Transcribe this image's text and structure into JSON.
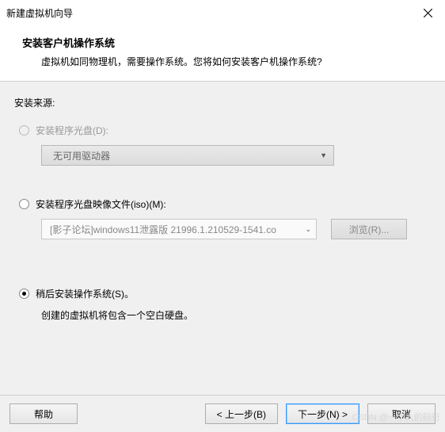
{
  "titlebar": {
    "title": "新建虚拟机向导"
  },
  "header": {
    "title": "安装客户机操作系统",
    "subtitle": "虚拟机如同物理机，需要操作系统。您将如何安装客户机操作系统?"
  },
  "source": {
    "label": "安装来源:"
  },
  "option_disc": {
    "label": "安装程序光盘(D):",
    "dropdown": "无可用驱动器"
  },
  "option_iso": {
    "label": "安装程序光盘映像文件(iso)(M):",
    "value": "[影子论坛]windows11泄露版 21996.1.210529-1541.co",
    "browse": "浏览(R)..."
  },
  "option_later": {
    "label": "稍后安装操作系统(S)。",
    "hint": "创建的虚拟机将包含一个空白硬盘。"
  },
  "footer": {
    "help": "帮助",
    "back": "< 上一步(B)",
    "next": "下一步(N) >",
    "cancel": "取消"
  },
  "watermark": "CSDN @一个人的码行"
}
